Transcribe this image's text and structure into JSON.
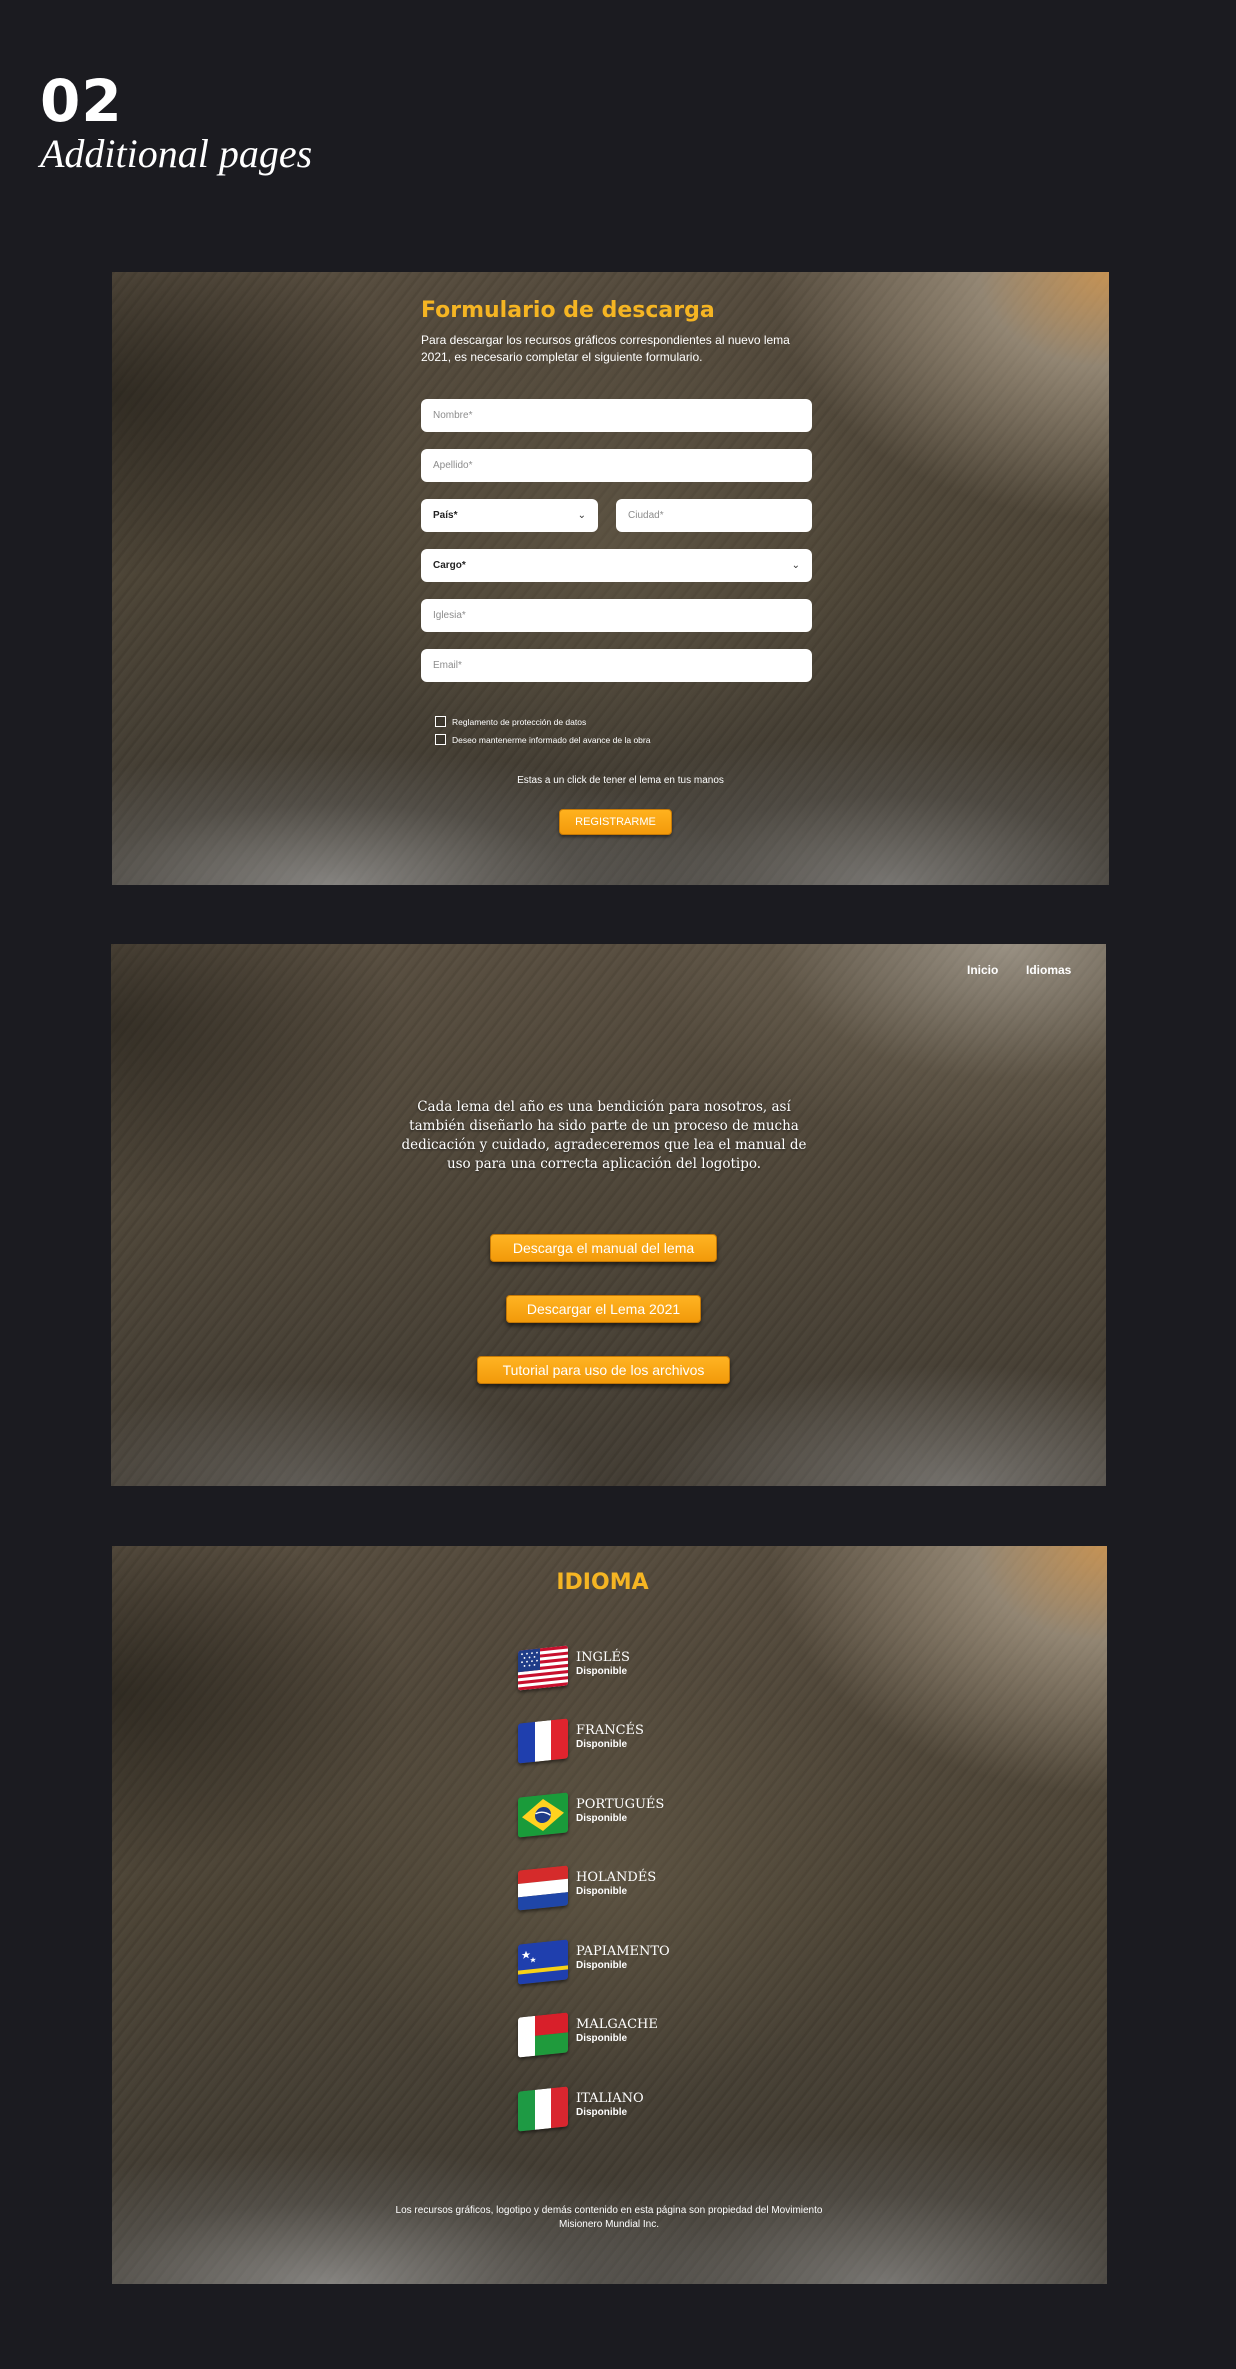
{
  "header": {
    "number": "02",
    "subtitle": "Additional pages"
  },
  "form_page": {
    "title": "Formulario de descarga",
    "description": "Para descargar los recursos gráficos correspondientes al nuevo lema 2021, es necesario completar el siguiente formulario.",
    "fields": {
      "nombre": "Nombre*",
      "apellido": "Apellido*",
      "pais": "País*",
      "ciudad": "Ciudad*",
      "cargo": "Cargo*",
      "iglesia": "Iglesia*",
      "email": "Email*"
    },
    "checkboxes": {
      "privacy": "Reglamento de protección de datos",
      "updates": "Deseo mantenerme informado del avance de la obra"
    },
    "cta_text": "Estas a un click de tener el lema en tus manos",
    "submit_label": "REGISTRARME"
  },
  "download_page": {
    "nav": {
      "home": "Inicio",
      "languages": "Idiomas"
    },
    "message": "Cada lema del año es una bendición para nosotros, así también diseñarlo ha sido parte de un proceso de mucha dedicación y cuidado, agradeceremos que lea el manual de uso para una correcta aplicación del logotipo.",
    "buttons": {
      "manual": "Descarga el manual del lema",
      "lema": "Descargar el Lema 2021",
      "tutorial": "Tutorial para uso de los archivos"
    }
  },
  "language_page": {
    "title": "IDIOMA",
    "languages": [
      {
        "name": "INGLÉS",
        "status": "Disponible",
        "flag_icon": "flag-usa-icon"
      },
      {
        "name": "FRANCÉS",
        "status": "Disponible",
        "flag_icon": "flag-france-icon"
      },
      {
        "name": "PORTUGUÉS",
        "status": "Disponible",
        "flag_icon": "flag-brazil-icon"
      },
      {
        "name": "HOLANDÉS",
        "status": "Disponible",
        "flag_icon": "flag-netherlands-icon"
      },
      {
        "name": "PAPIAMENTO",
        "status": "Disponible",
        "flag_icon": "flag-curacao-icon"
      },
      {
        "name": "MALGACHE",
        "status": "Disponible",
        "flag_icon": "flag-madagascar-icon"
      },
      {
        "name": "ITALIANO",
        "status": "Disponible",
        "flag_icon": "flag-italy-icon"
      }
    ],
    "footer": "Los recursos gráficos, logotipo y demás contenido en esta página son propiedad del Movimiento Misionero Mundial Inc."
  },
  "colors": {
    "background": "#1b1b20",
    "accent": "#f5b523",
    "button": "#f7a412"
  }
}
